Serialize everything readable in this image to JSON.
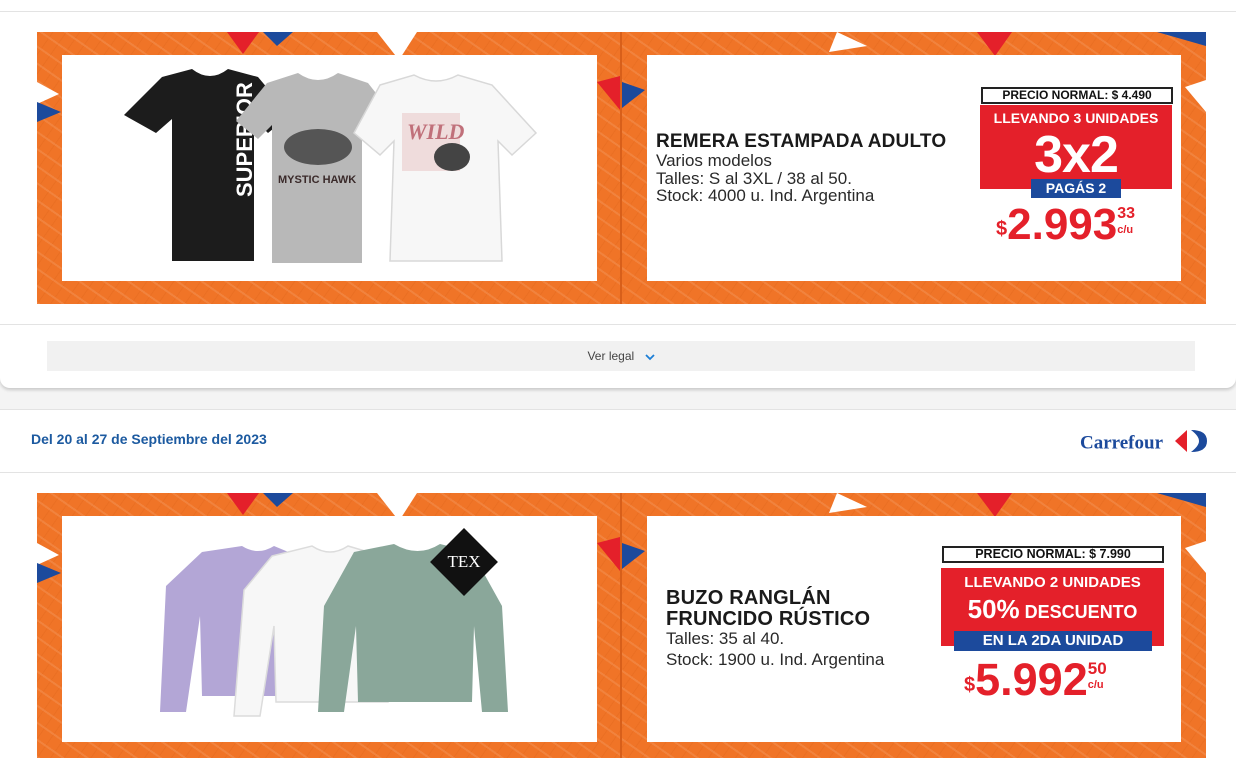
{
  "offer1": {
    "title": "REMERA ESTAMPADA ADULTO",
    "line1": "Varios modelos",
    "line2": "Talles: S al 3XL  / 38 al 50.",
    "line3": "Stock: 4000 u. Ind. Argentina",
    "normal_price": "PRECIO NORMAL: $ 4.490",
    "promo_line": "LLEVANDO 3 UNIDADES",
    "promo_big": "3x2",
    "promo_sub": "PAGÁS 2",
    "currency": "$",
    "price_int": "2.993",
    "price_cents": "33",
    "unit": "c/u"
  },
  "shirt_prints": [
    "SUPERIOR",
    "MYSTIC HAWK",
    "WILD"
  ],
  "legal": {
    "label": "Ver legal",
    "icon": "chevron-down-icon"
  },
  "header2": {
    "dates": "Del 20 al 27 de Septiembre del 2023",
    "brand": "Carrefour"
  },
  "offer2": {
    "badge": "TEX",
    "title_1": "BUZO RANGLÁN",
    "title_2": "FRUNCIDO RÚSTICO",
    "line1": "Talles: 35 al 40.",
    "line2": "Stock: 1900 u. Ind. Argentina",
    "normal_price": "PRECIO NORMAL: $ 7.990",
    "promo_line": "LLEVANDO 2 UNIDADES",
    "promo_pct": "50%",
    "promo_word": " DESCUENTO",
    "promo_sub": "EN LA 2DA UNIDAD",
    "currency": "$",
    "price_int": "5.992",
    "price_cents": "50",
    "unit": "c/u"
  },
  "colors": {
    "orange": "#f07427",
    "red": "#e4202a",
    "blue": "#1c4a9c",
    "date_blue": "#1c5aa0"
  }
}
